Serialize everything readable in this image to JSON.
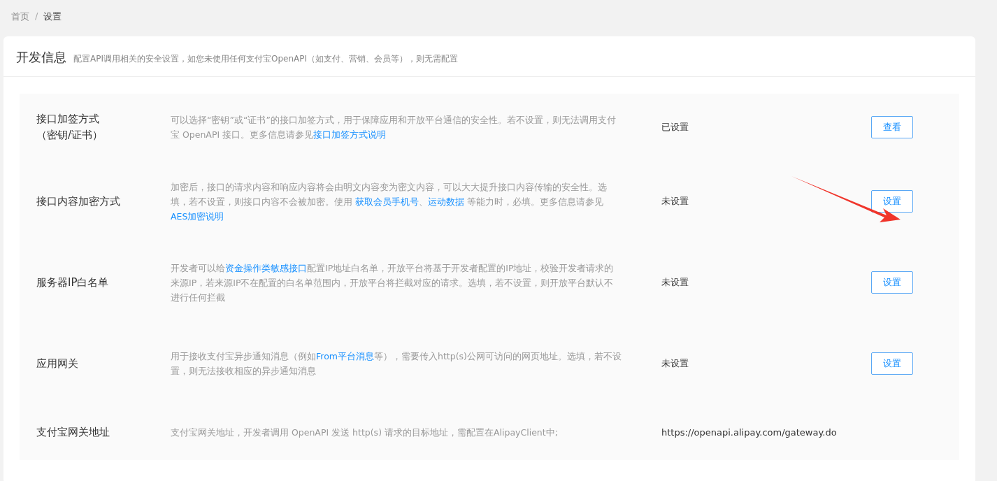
{
  "breadcrumb": [
    {
      "label": "首页",
      "selected": false
    },
    {
      "label": "设置",
      "selected": true
    }
  ],
  "breadcrumb_separator": "/",
  "card": {
    "title": "开发信息",
    "subtitle": "配置API调用相关的安全设置，如您未使用任何支付宝OpenAPI（如支付、营销、会员等），则无需配置"
  },
  "rows": [
    {
      "label_lines": [
        "接口加签方式",
        "（密钥/证书）"
      ],
      "description": [
        {
          "kind": "text",
          "text": "可以选择“密钥”或“证书”的接口加签方式，用于保障应用和开放平台通信的安全性。若不设置，则无法调用支付宝 OpenAPI 接口。更多信息请参见"
        },
        {
          "kind": "link",
          "text": "接口加签方式说明"
        }
      ],
      "status": "已设置",
      "button": "查看"
    },
    {
      "label_lines": [
        "接口内容加密方式"
      ],
      "description": [
        {
          "kind": "text",
          "text": "加密后，接口的请求内容和响应内容将会由明文内容变为密文内容，可以大大提升接口内容传输的安全性。选填，若不设置，则接口内容不会被加密。使用 "
        },
        {
          "kind": "link",
          "text": "获取会员手机号"
        },
        {
          "kind": "text",
          "text": "、"
        },
        {
          "kind": "link",
          "text": "运动数据"
        },
        {
          "kind": "text",
          "text": " 等能力时，必填。更多信息请参见"
        },
        {
          "kind": "link",
          "text": "AES加密说明"
        }
      ],
      "status": "未设置",
      "button": "设置"
    },
    {
      "label_lines": [
        "服务器IP白名单"
      ],
      "description": [
        {
          "kind": "text",
          "text": "开发者可以给"
        },
        {
          "kind": "link",
          "text": "资金操作类敏感接口"
        },
        {
          "kind": "text",
          "text": "配置IP地址白名单，开放平台将基于开发者配置的IP地址，校验开发者请求的来源IP，若来源IP不在配置的白名单范围内，开放平台将拦截对应的请求。选填，若不设置，则开放平台默认不进行任何拦截"
        }
      ],
      "status": "未设置",
      "button": "设置"
    },
    {
      "label_lines": [
        "应用网关"
      ],
      "description": [
        {
          "kind": "text",
          "text": "用于接收支付宝异步通知消息（例如"
        },
        {
          "kind": "link",
          "text": "From平台消息"
        },
        {
          "kind": "text",
          "text": "等），需要传入http(s)公网可访问的网页地址。选填，若不设置，则无法接收相应的异步通知消息"
        }
      ],
      "status": "未设置",
      "button": "设置"
    },
    {
      "label_lines": [
        "支付宝网关地址"
      ],
      "description": [
        {
          "kind": "text",
          "text": "支付宝网关地址，开发者调用 OpenAPI 发送 http(s) 请求的目标地址，需配置在AlipayClient中;"
        }
      ],
      "status": "https://openapi.alipay.com/gateway.do"
    }
  ]
}
